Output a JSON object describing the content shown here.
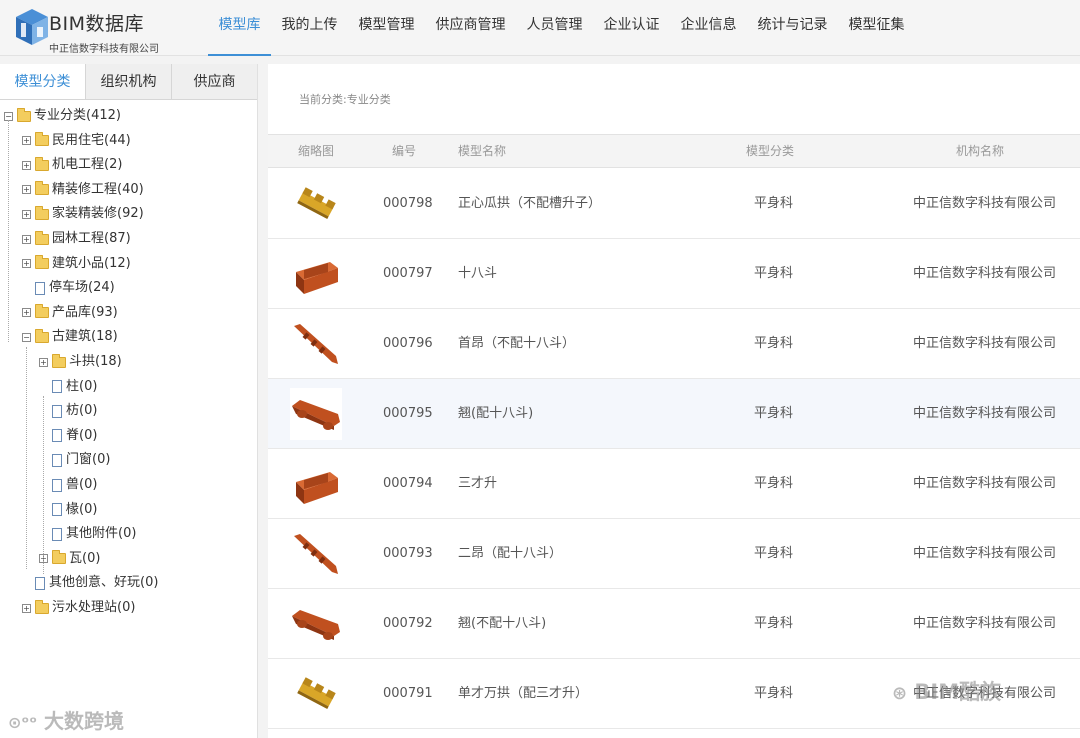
{
  "header": {
    "brand": "BIM数据库",
    "company": "中正信数字科技有限公司",
    "nav": [
      "模型库",
      "我的上传",
      "模型管理",
      "供应商管理",
      "人员管理",
      "企业认证",
      "企业信息",
      "统计与记录",
      "模型征集"
    ],
    "active_nav": "模型库"
  },
  "sidebar": {
    "tabs": [
      "模型分类",
      "组织机构",
      "供应商"
    ],
    "tree": [
      {
        "label": "专业分类(412)",
        "type": "folder",
        "toggle": "⊟"
      },
      {
        "label": "民用住宅(44)",
        "type": "folder",
        "toggle": "⊞"
      },
      {
        "label": "机电工程(2)",
        "type": "folder",
        "toggle": "⊞"
      },
      {
        "label": "精装修工程(40)",
        "type": "folder",
        "toggle": "⊞"
      },
      {
        "label": "家装精装修(92)",
        "type": "folder",
        "toggle": "⊞"
      },
      {
        "label": "园林工程(87)",
        "type": "folder",
        "toggle": "⊞"
      },
      {
        "label": "建筑小品(12)",
        "type": "folder",
        "toggle": "⊞"
      },
      {
        "label": "停车场(24)",
        "type": "doc",
        "toggle": ""
      },
      {
        "label": "产品库(93)",
        "type": "folder",
        "toggle": "⊞"
      },
      {
        "label": "古建筑(18)",
        "type": "folder",
        "toggle": "⊟"
      },
      {
        "label": "斗拱(18)",
        "type": "folder",
        "toggle": "⊞"
      },
      {
        "label": "柱(0)",
        "type": "doc",
        "toggle": ""
      },
      {
        "label": "枋(0)",
        "type": "doc",
        "toggle": ""
      },
      {
        "label": "脊(0)",
        "type": "doc",
        "toggle": ""
      },
      {
        "label": "门窗(0)",
        "type": "doc",
        "toggle": ""
      },
      {
        "label": "兽(0)",
        "type": "doc",
        "toggle": ""
      },
      {
        "label": "椽(0)",
        "type": "doc",
        "toggle": ""
      },
      {
        "label": "其他附件(0)",
        "type": "doc",
        "toggle": ""
      },
      {
        "label": "瓦(0)",
        "type": "folder",
        "toggle": "⊞"
      },
      {
        "label": "其他创意、好玩(0)",
        "type": "doc",
        "toggle": ""
      },
      {
        "label": "污水处理站(0)",
        "type": "folder",
        "toggle": "⊞"
      }
    ]
  },
  "main": {
    "breadcrumb": "当前分类:专业分类",
    "columns": [
      "缩略图",
      "编号",
      "模型名称",
      "模型分类",
      "机构名称"
    ],
    "rows": [
      {
        "id": "000798",
        "name": "正心瓜拱（不配槽升子）",
        "category": "平身科",
        "org": "中正信数字科技有限公司",
        "thumb": "gold-bracket"
      },
      {
        "id": "000797",
        "name": "十八斗",
        "category": "平身科",
        "org": "中正信数字科技有限公司",
        "thumb": "dou-block"
      },
      {
        "id": "000796",
        "name": "首昂（不配十八斗）",
        "category": "平身科",
        "org": "中正信数字科技有限公司",
        "thumb": "ang-arm"
      },
      {
        "id": "000795",
        "name": "翘(配十八斗)",
        "category": "平身科",
        "org": "中正信数字科技有限公司",
        "thumb": "qiao-arm"
      },
      {
        "id": "000794",
        "name": "三才升",
        "category": "平身科",
        "org": "中正信数字科技有限公司",
        "thumb": "dou-block"
      },
      {
        "id": "000793",
        "name": "二昂（配十八斗）",
        "category": "平身科",
        "org": "中正信数字科技有限公司",
        "thumb": "ang-arm"
      },
      {
        "id": "000792",
        "name": "翘(不配十八斗)",
        "category": "平身科",
        "org": "中正信数字科技有限公司",
        "thumb": "qiao-arm"
      },
      {
        "id": "000791",
        "name": "单才万拱（配三才升）",
        "category": "平身科",
        "org": "中正信数字科技有限公司",
        "thumb": "gold-bracket"
      }
    ]
  },
  "watermarks": {
    "left": "大数跨境",
    "right": "BIM酷族"
  },
  "colors": {
    "accent": "#3d8fd6",
    "wood": "#c0501f",
    "gold": "#d9a628"
  }
}
